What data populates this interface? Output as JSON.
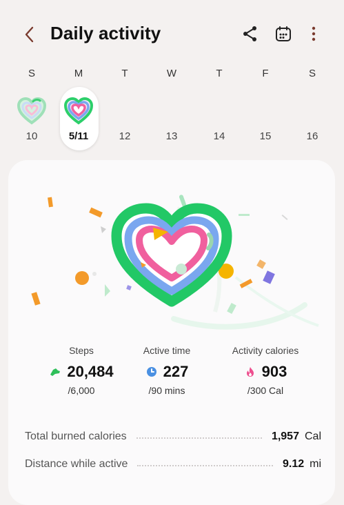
{
  "header": {
    "title": "Daily activity",
    "icons": [
      "back-chevron-icon",
      "share-icon",
      "calendar-icon",
      "more-vert-icon"
    ],
    "accent": "#7a3b2e"
  },
  "week": {
    "days": [
      {
        "dow": "S",
        "date": "10"
      },
      {
        "dow": "M",
        "date": "5/11",
        "selected": true
      },
      {
        "dow": "T",
        "date": "12"
      },
      {
        "dow": "W",
        "date": "13"
      },
      {
        "dow": "T",
        "date": "14"
      },
      {
        "dow": "F",
        "date": "15"
      },
      {
        "dow": "S",
        "date": "16"
      }
    ]
  },
  "stats": {
    "steps": {
      "label": "Steps",
      "value": "20,484",
      "goal": "/6,000",
      "icon": "steps-shoe-icon",
      "color": "#2fbf5a"
    },
    "active_time": {
      "label": "Active time",
      "value": "227",
      "goal": "/90 mins",
      "icon": "clock-icon",
      "color": "#4a90e2"
    },
    "activity_calories": {
      "label": "Activity calories",
      "value": "903",
      "goal": "/300 Cal",
      "icon": "flame-icon",
      "color": "#ee4f8f"
    }
  },
  "summary": {
    "total_burned": {
      "label": "Total burned calories",
      "value": "1,957",
      "unit": "Cal"
    },
    "distance": {
      "label": "Distance while active",
      "value": "9.12",
      "unit": "mi"
    }
  },
  "rings": {
    "colors": {
      "steps": "#2ccf6a",
      "active_time": "#7aa7ef",
      "calories": "#f0609e"
    }
  }
}
